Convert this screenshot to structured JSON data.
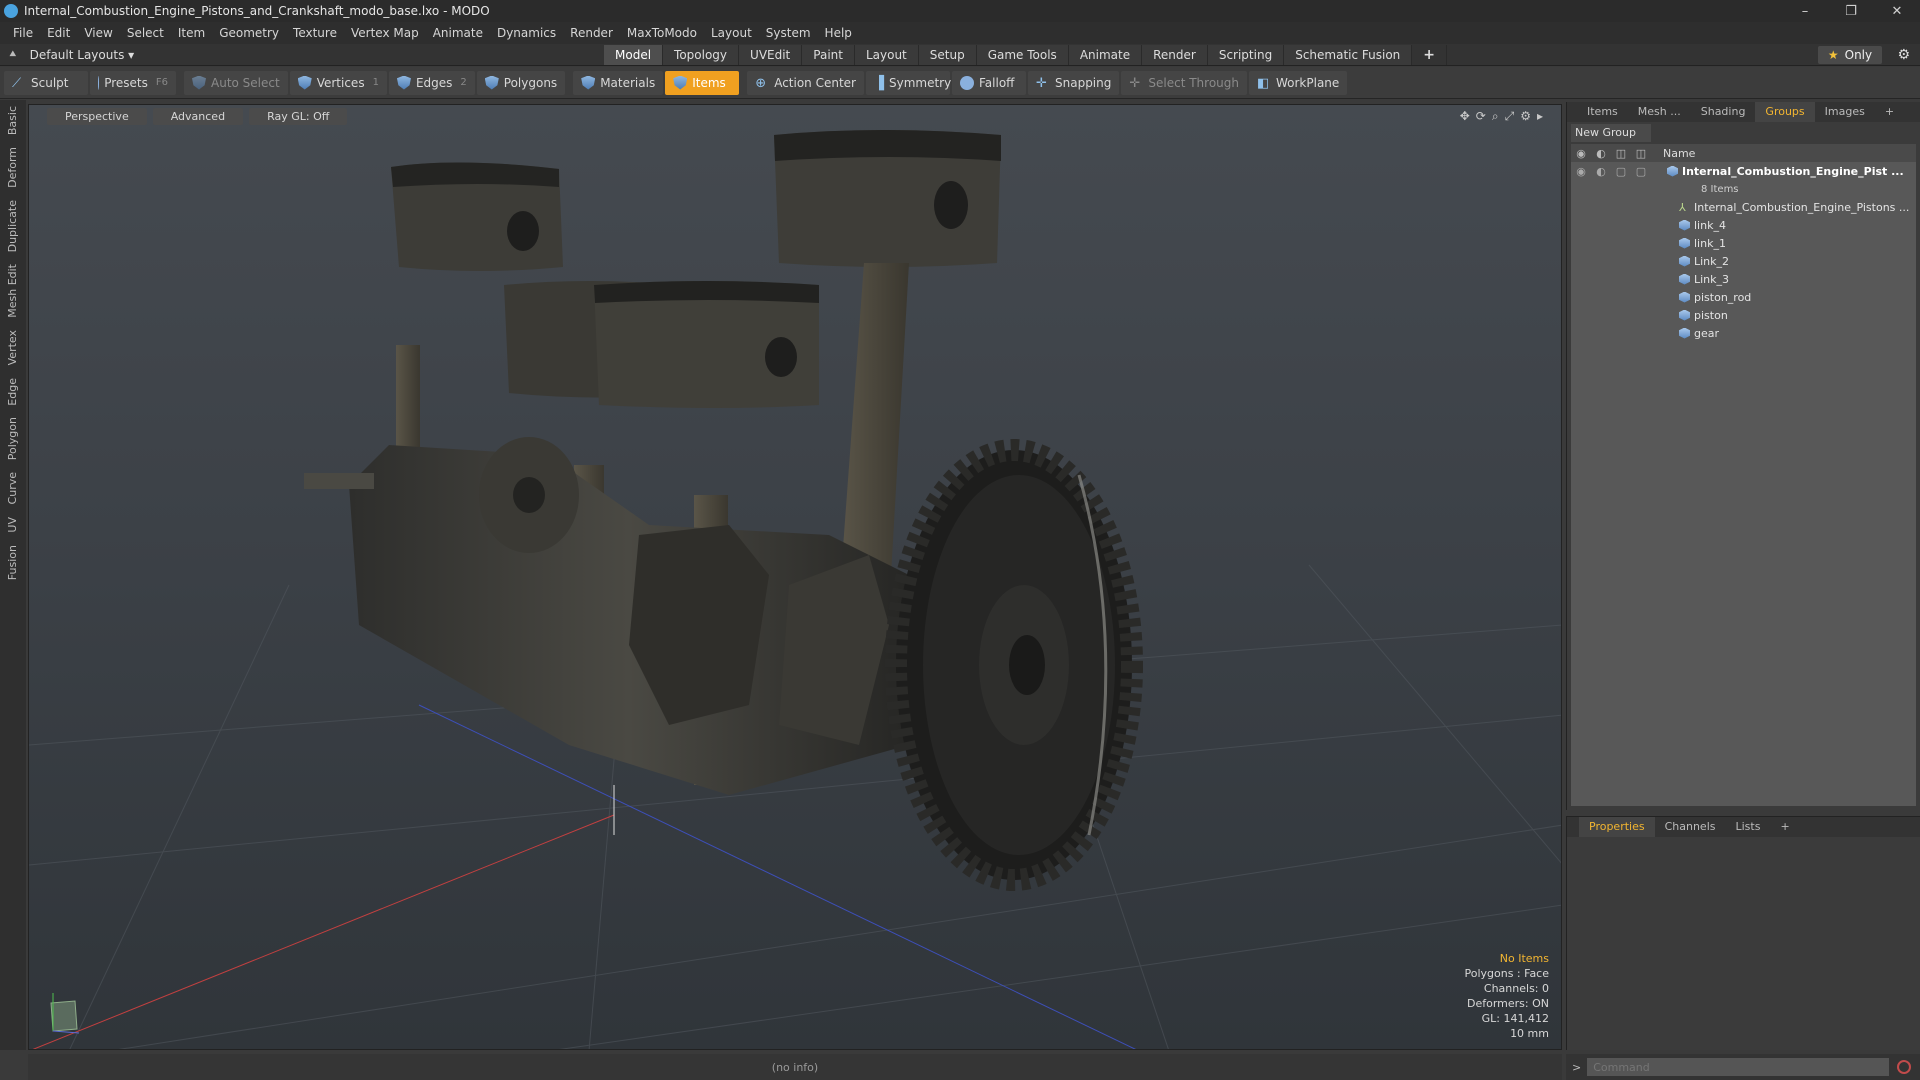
{
  "window": {
    "title": "Internal_Combustion_Engine_Pistons_and_Crankshaft_modo_base.lxo - MODO",
    "minimize": "–",
    "restore": "❐",
    "close": "✕"
  },
  "menu": [
    "File",
    "Edit",
    "View",
    "Select",
    "Item",
    "Geometry",
    "Texture",
    "Vertex Map",
    "Animate",
    "Dynamics",
    "Render",
    "MaxToModo",
    "Layout",
    "System",
    "Help"
  ],
  "layout_bar": {
    "layouts_label": "Default Layouts ▾",
    "tabs": [
      "Model",
      "Topology",
      "UVEdit",
      "Paint",
      "Layout",
      "Setup",
      "Game Tools",
      "Animate",
      "Render",
      "Scripting",
      "Schematic Fusion"
    ],
    "active_tab": "Model",
    "only_label": "Only"
  },
  "toolbar": {
    "sculpt": "Sculpt",
    "presets": "Presets",
    "presets_hotkey": "F6",
    "auto_select": "Auto Select",
    "vertices": "Vertices",
    "vertices_key": "1",
    "edges": "Edges",
    "edges_key": "2",
    "polygons": "Polygons",
    "materials": "Materials",
    "items": "Items",
    "action_center": "Action Center",
    "symmetry": "Symmetry",
    "falloff": "Falloff",
    "snapping": "Snapping",
    "select_through": "Select Through",
    "workplane": "WorkPlane"
  },
  "left_tabs": [
    "Basic",
    "Deform",
    "Duplicate",
    "Mesh Edit",
    "Vertex",
    "Edge",
    "Polygon",
    "Curve",
    "UV",
    "Fusion"
  ],
  "viewport": {
    "view_mode": "Perspective",
    "shading": "Advanced",
    "raygl": "Ray GL: Off",
    "hud": {
      "selection": "No Items",
      "polygons": "Polygons : Face",
      "channels": "Channels: 0",
      "deformers": "Deformers: ON",
      "gl": "GL: 141,412",
      "scale": "10 mm"
    }
  },
  "status": {
    "info": "(no info)"
  },
  "items_panel": {
    "tabs": [
      "Items",
      "Mesh ...",
      "Shading",
      "Groups",
      "Images"
    ],
    "active_tab": "Groups",
    "new_group": "New Group",
    "col_name": "Name",
    "group_name": "Internal_Combustion_Engine_Pist ...",
    "group_count": "8 Items",
    "items": [
      {
        "name": "Internal_Combustion_Engine_Pistons ...",
        "kind": "locator"
      },
      {
        "name": "link_4",
        "kind": "mesh"
      },
      {
        "name": "link_1",
        "kind": "mesh"
      },
      {
        "name": "Link_2",
        "kind": "mesh"
      },
      {
        "name": "Link_3",
        "kind": "mesh"
      },
      {
        "name": "piston_rod",
        "kind": "mesh"
      },
      {
        "name": "piston",
        "kind": "mesh"
      },
      {
        "name": "gear",
        "kind": "mesh"
      }
    ]
  },
  "properties_panel": {
    "tabs": [
      "Properties",
      "Channels",
      "Lists"
    ],
    "active_tab": "Properties"
  },
  "command": {
    "placeholder": "Command"
  },
  "colors": {
    "accent": "#f2b531",
    "active_tool": "#f0a020"
  }
}
